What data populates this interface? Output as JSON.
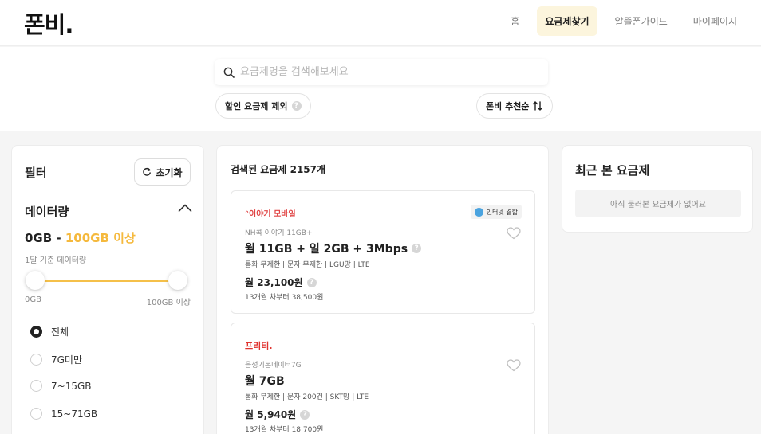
{
  "header": {
    "logo": "폰비.",
    "nav": [
      "홈",
      "요금제찾기",
      "알뜰폰가이드",
      "마이페이지"
    ],
    "active_nav": "요금제찾기"
  },
  "search": {
    "placeholder": "요금제명을 검색해보세요",
    "discount_label": "할인 요금제 제외",
    "sort_label": "폰비 추천순"
  },
  "filter": {
    "title": "필터",
    "reset_label": "초기화",
    "data_section": {
      "title": "데이터량",
      "range_low": "0GB",
      "range_sep": " - ",
      "range_high": "100GB 이상",
      "subtitle": "1달 기준 데이터량",
      "min_label": "0GB",
      "max_label": "100GB 이상"
    },
    "options": [
      "전체",
      "7G미만",
      "7~15GB",
      "15~71GB"
    ],
    "selected_option": "전체"
  },
  "results": {
    "count_label": "검색된 요금제 2157개",
    "plans": [
      {
        "carrier": "°이야기 모바일",
        "badge": "인터넷 결합",
        "name": "NH콕 이야기 11GB+",
        "data": "월 11GB + 일 2GB + 3Mbps",
        "specs": "통화 무제한  |  문자 무제한  |  LGU망  |  LTE",
        "price": "월 23,100원",
        "after": "13개월 차부터 38,500원"
      },
      {
        "carrier": "프리티.",
        "badge": "",
        "name": "음성기본데이터7G",
        "data": "월 7GB",
        "specs": "통화 무제한  |  문자 200건  |  SKT망  |  LTE",
        "price": "월 5,940원",
        "after": "13개월 차부터 18,700원"
      }
    ]
  },
  "recent": {
    "title": "최근 본 요금제",
    "empty": "아직 둘러본 요금제가 없어요"
  },
  "colors": {
    "accent": "#f5b93d",
    "nav_active_bg": "#fcf5dd",
    "carrier1": "#e04545",
    "carrier2": "#e0342f"
  }
}
